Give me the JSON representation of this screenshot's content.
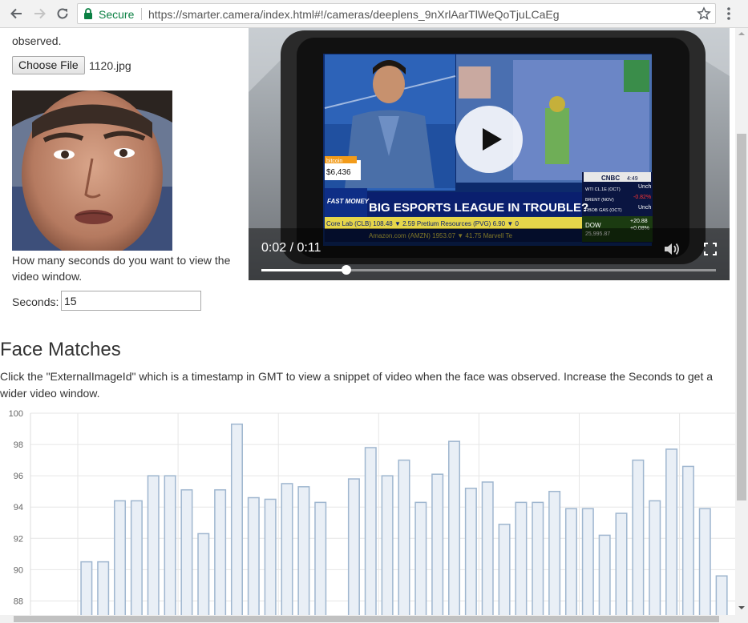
{
  "browser": {
    "secure_label": "Secure",
    "url": "https://smarter.camera/index.html#!/cameras/deeplens_9nXrlAarTlWeQoTjuLCaEg"
  },
  "upload": {
    "observed_text": "observed.",
    "choose_file_label": "Choose File",
    "file_name": "1120.jpg"
  },
  "seconds": {
    "question": "How many seconds do you want to view the video window.",
    "label": "Seconds:",
    "value": "15"
  },
  "video": {
    "time": "0:02 / 0:11",
    "progress": 0.187,
    "overlay_texts": {
      "headline": "BIG ESPORTS LEAGUE IN TROUBLE?",
      "network": "CNBC",
      "fast_money": "FAST MONEY",
      "bitcoin": "bitcoin",
      "bitcoin_price": "$6,436",
      "ticker": "Core Lab (CLB) 108.48 ▼ 2.59    Pretium Resources (PVG) 6.90 ▼ 0",
      "ticker2": "Amazon.com (AMZN) 1953.07 ▼ 41.75    Marvell Te",
      "dow": "DOW",
      "dow_value": "25,995.87",
      "dow_change": "+20.88",
      "dow_pct": "+0.08%",
      "oil1": "WTI CL.1E (OCT)",
      "oil2": "BRENT (NOV)",
      "oil3": "RBOB GAS (OCT)",
      "unch1": "Unch",
      "pct": "-0.82%",
      "unch2": "Unch",
      "time": "4:49"
    }
  },
  "matches": {
    "title": "Face Matches",
    "description": "Click the \"ExternalImageId\" which is a timestamp in GMT to view a snippet of video when the face was observed. Increase the Seconds to get a wider video window."
  },
  "chart_data": {
    "type": "bar",
    "ylim": [
      87,
      100
    ],
    "yticks": [
      88,
      90,
      92,
      94,
      96,
      98,
      100
    ],
    "values": [
      null,
      null,
      null,
      null,
      90.5,
      90.5,
      94.4,
      94.4,
      96.0,
      96.0,
      95.1,
      92.3,
      95.1,
      99.3,
      94.6,
      94.5,
      95.5,
      95.3,
      94.3,
      null,
      95.8,
      97.8,
      96.0,
      97.0,
      94.3,
      96.1,
      98.2,
      95.2,
      95.6,
      92.9,
      94.3,
      94.3,
      95.0,
      93.9,
      93.9,
      92.2,
      93.6,
      97.0,
      94.4,
      97.7,
      96.6,
      93.9,
      89.6
    ],
    "bar_color": "#e9eff6",
    "bar_border": "#9fb6cf",
    "grid": true
  }
}
